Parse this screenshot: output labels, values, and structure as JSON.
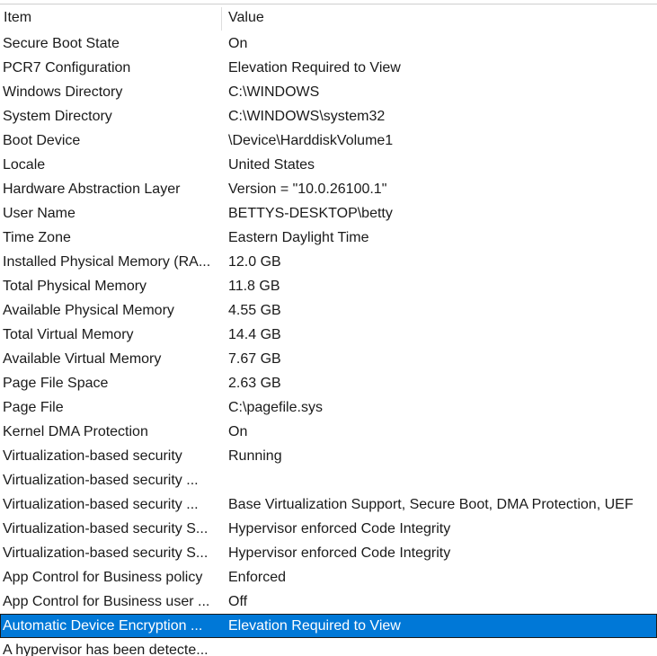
{
  "header": {
    "item": "Item",
    "value": "Value"
  },
  "rows": [
    {
      "item": "Secure Boot State",
      "value": "On"
    },
    {
      "item": "PCR7 Configuration",
      "value": "Elevation Required to View"
    },
    {
      "item": "Windows Directory",
      "value": "C:\\WINDOWS"
    },
    {
      "item": "System Directory",
      "value": "C:\\WINDOWS\\system32"
    },
    {
      "item": "Boot Device",
      "value": "\\Device\\HarddiskVolume1"
    },
    {
      "item": "Locale",
      "value": "United States"
    },
    {
      "item": "Hardware Abstraction Layer",
      "value": "Version = \"10.0.26100.1\""
    },
    {
      "item": "User Name",
      "value": "BETTYS-DESKTOP\\betty"
    },
    {
      "item": "Time Zone",
      "value": "Eastern Daylight Time"
    },
    {
      "item": "Installed Physical Memory (RA...",
      "value": "12.0 GB"
    },
    {
      "item": "Total Physical Memory",
      "value": "11.8 GB"
    },
    {
      "item": "Available Physical Memory",
      "value": "4.55 GB"
    },
    {
      "item": "Total Virtual Memory",
      "value": "14.4 GB"
    },
    {
      "item": "Available Virtual Memory",
      "value": "7.67 GB"
    },
    {
      "item": "Page File Space",
      "value": "2.63 GB"
    },
    {
      "item": "Page File",
      "value": "C:\\pagefile.sys"
    },
    {
      "item": "Kernel DMA Protection",
      "value": "On"
    },
    {
      "item": "Virtualization-based security",
      "value": "Running"
    },
    {
      "item": "Virtualization-based security ...",
      "value": ""
    },
    {
      "item": "Virtualization-based security ...",
      "value": "Base Virtualization Support, Secure Boot, DMA Protection, UEF"
    },
    {
      "item": "Virtualization-based security S...",
      "value": "Hypervisor enforced Code Integrity"
    },
    {
      "item": "Virtualization-based security S...",
      "value": "Hypervisor enforced Code Integrity"
    },
    {
      "item": "App Control for Business policy",
      "value": "Enforced"
    },
    {
      "item": "App Control for Business user ...",
      "value": "Off"
    },
    {
      "item": "Automatic Device Encryption ...",
      "value": "Elevation Required to View"
    },
    {
      "item": "A hypervisor has been detecte...",
      "value": ""
    }
  ],
  "selected_row_index": 24,
  "colors": {
    "selection": "#0078d7",
    "text": "#1a1a1a",
    "background": "#ffffff"
  }
}
